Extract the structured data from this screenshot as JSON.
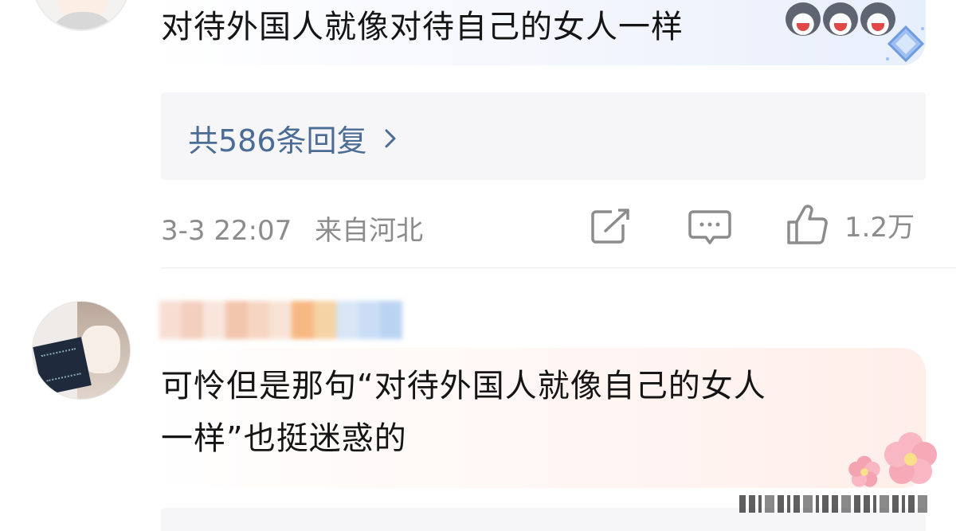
{
  "comment1": {
    "text": "对待外国人就像对待自己的女人一样",
    "emoji": [
      "husky-face-icon",
      "husky-face-icon",
      "husky-face-icon"
    ]
  },
  "replies": {
    "label": "共586条回复",
    "color": "#4a6c95"
  },
  "meta": {
    "timestamp": "3-3 22:07",
    "location": "来自河北",
    "like_count": "1.2万"
  },
  "comment2": {
    "line1": "可怜但是那句“对待外国人就像自己的女人",
    "line2": "一样”也挺迷惑的"
  },
  "colors": {
    "link": "#4a6c95",
    "meta": "#8c8c8c",
    "replies_bg": "#f6f6f8",
    "bubble1_tint": "#e8effc",
    "bubble2_tint": "#ffeeea"
  }
}
